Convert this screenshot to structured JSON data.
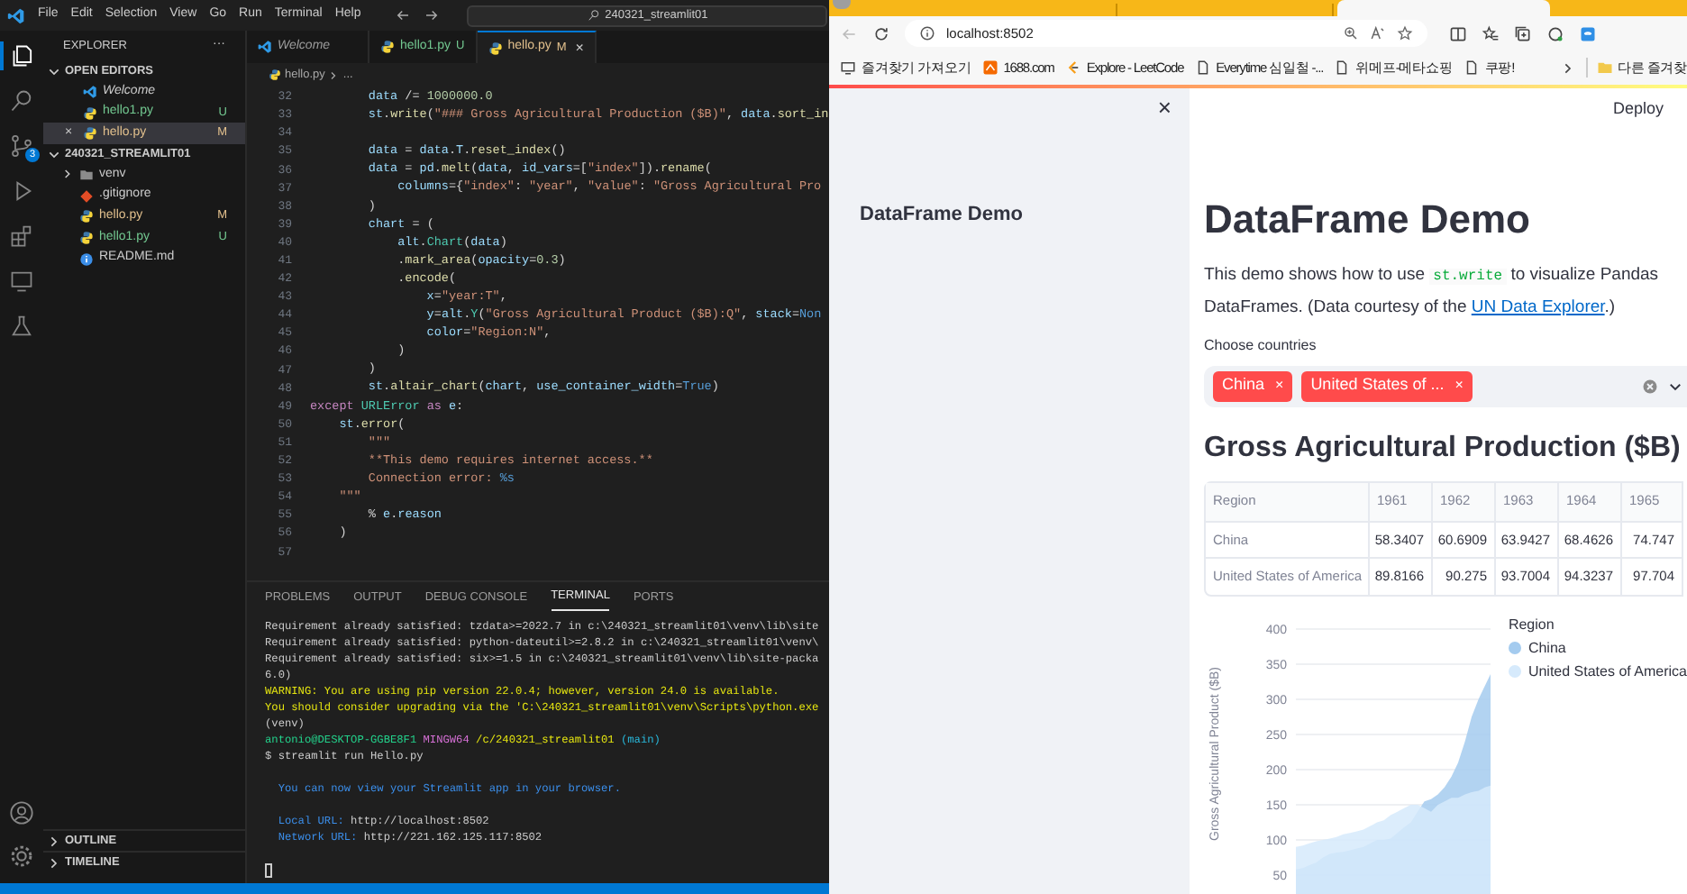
{
  "vscode": {
    "menu": [
      "File",
      "Edit",
      "Selection",
      "View",
      "Go",
      "Run",
      "Terminal",
      "Help"
    ],
    "command_center": "240321_streamlit01",
    "activity_bar": [
      {
        "kind": "explorer",
        "selected": true
      },
      {
        "kind": "search",
        "selected": false
      },
      {
        "kind": "source-control",
        "selected": false,
        "badge": "3"
      },
      {
        "kind": "run",
        "selected": false
      },
      {
        "kind": "extensions",
        "selected": false
      },
      {
        "kind": "remote",
        "selected": false
      },
      {
        "kind": "testing",
        "selected": false
      }
    ],
    "explorer": {
      "title": "EXPLORER",
      "more": "···",
      "open_editors": {
        "title": "OPEN EDITORS",
        "expanded": true,
        "items": [
          {
            "name": "Welcome",
            "kind": "vscode",
            "selected": false,
            "italic": true
          },
          {
            "name": "hello1.py",
            "kind": "python",
            "status": "U",
            "selected": false,
            "italic": false
          },
          {
            "name": "hello.py",
            "kind": "python",
            "status": "M",
            "selected": true,
            "italic": false,
            "close": "×"
          }
        ]
      },
      "folder": {
        "title": "240321_STREAMLIT01",
        "expanded": true,
        "items": [
          {
            "name": "venv",
            "kind": "folder"
          },
          {
            "name": ".gitignore",
            "kind": "git"
          },
          {
            "name": "hello.py",
            "kind": "python",
            "status": "M"
          },
          {
            "name": "hello1.py",
            "kind": "python",
            "status": "U"
          },
          {
            "name": "README.md",
            "kind": "info"
          }
        ]
      },
      "bottom_sections": [
        "OUTLINE",
        "TIMELINE"
      ]
    },
    "tabs": [
      {
        "label": "Welcome",
        "kind": "vscode",
        "selected": false
      },
      {
        "label": "hello1.py",
        "kind": "python",
        "status": "U",
        "selected": false
      },
      {
        "label": "hello.py",
        "kind": "python",
        "status": "M",
        "selected": true,
        "close": "×"
      }
    ],
    "breadcrumb": [
      "hello.py",
      "..."
    ],
    "code": [
      {
        "number": "32",
        "tokens": [
          {
            "kind": "var",
            "text": "        data"
          },
          {
            "kind": "op",
            "text": " /= "
          },
          {
            "kind": "num",
            "text": "1000000.0"
          }
        ]
      },
      {
        "number": "33",
        "tokens": [
          {
            "kind": "var",
            "text": "        st"
          },
          {
            "kind": "op",
            "text": "."
          },
          {
            "kind": "fn",
            "text": "write"
          },
          {
            "kind": "op",
            "text": "("
          },
          {
            "kind": "str",
            "text": "\"### Gross Agricultural Production ($B)\""
          },
          {
            "kind": "op",
            "text": ", "
          },
          {
            "kind": "var",
            "text": "data"
          },
          {
            "kind": "op",
            "text": "."
          },
          {
            "kind": "fn",
            "text": "sort_in"
          }
        ]
      },
      {
        "number": "34"
      },
      {
        "number": "35",
        "tokens": [
          {
            "kind": "var",
            "text": "        data"
          },
          {
            "kind": "op",
            "text": " = "
          },
          {
            "kind": "var",
            "text": "data"
          },
          {
            "kind": "op",
            "text": "."
          },
          {
            "kind": "var",
            "text": "T"
          },
          {
            "kind": "op",
            "text": "."
          },
          {
            "kind": "fn",
            "text": "reset_index"
          },
          {
            "kind": "op",
            "text": "()"
          }
        ]
      },
      {
        "number": "36",
        "tokens": [
          {
            "kind": "var",
            "text": "        data"
          },
          {
            "kind": "op",
            "text": " = "
          },
          {
            "kind": "var",
            "text": "pd"
          },
          {
            "kind": "op",
            "text": "."
          },
          {
            "kind": "fn",
            "text": "melt"
          },
          {
            "kind": "op",
            "text": "("
          },
          {
            "kind": "var",
            "text": "data"
          },
          {
            "kind": "op",
            "text": ", "
          },
          {
            "kind": "var",
            "text": "id_vars"
          },
          {
            "kind": "op",
            "text": "=["
          },
          {
            "kind": "str",
            "text": "\"index\""
          },
          {
            "kind": "op",
            "text": "])."
          },
          {
            "kind": "fn",
            "text": "rename"
          },
          {
            "kind": "op",
            "text": "("
          }
        ]
      },
      {
        "number": "37",
        "tokens": [
          {
            "kind": "var",
            "text": "            columns"
          },
          {
            "kind": "op",
            "text": "={"
          },
          {
            "kind": "str",
            "text": "\"index\""
          },
          {
            "kind": "op",
            "text": ": "
          },
          {
            "kind": "str",
            "text": "\"year\""
          },
          {
            "kind": "op",
            "text": ", "
          },
          {
            "kind": "str",
            "text": "\"value\""
          },
          {
            "kind": "op",
            "text": ": "
          },
          {
            "kind": "str",
            "text": "\"Gross Agricultural Pro"
          }
        ]
      },
      {
        "number": "38",
        "tokens": [
          {
            "kind": "op",
            "text": "        )"
          }
        ]
      },
      {
        "number": "39",
        "tokens": [
          {
            "kind": "var",
            "text": "        chart"
          },
          {
            "kind": "op",
            "text": " = ("
          }
        ]
      },
      {
        "number": "40",
        "tokens": [
          {
            "kind": "var",
            "text": "            alt"
          },
          {
            "kind": "op",
            "text": "."
          },
          {
            "kind": "cls",
            "text": "Chart"
          },
          {
            "kind": "op",
            "text": "("
          },
          {
            "kind": "var",
            "text": "data"
          },
          {
            "kind": "op",
            "text": ")"
          }
        ]
      },
      {
        "number": "41",
        "tokens": [
          {
            "kind": "op",
            "text": "            ."
          },
          {
            "kind": "fn",
            "text": "mark_area"
          },
          {
            "kind": "op",
            "text": "("
          },
          {
            "kind": "var",
            "text": "opacity"
          },
          {
            "kind": "op",
            "text": "="
          },
          {
            "kind": "num",
            "text": "0.3"
          },
          {
            "kind": "op",
            "text": ")"
          }
        ]
      },
      {
        "number": "42",
        "tokens": [
          {
            "kind": "op",
            "text": "            ."
          },
          {
            "kind": "fn",
            "text": "encode"
          },
          {
            "kind": "op",
            "text": "("
          }
        ]
      },
      {
        "number": "43",
        "tokens": [
          {
            "kind": "var",
            "text": "                x"
          },
          {
            "kind": "op",
            "text": "="
          },
          {
            "kind": "str",
            "text": "\"year:T\""
          },
          {
            "kind": "op",
            "text": ","
          }
        ]
      },
      {
        "number": "44",
        "tokens": [
          {
            "kind": "var",
            "text": "                y"
          },
          {
            "kind": "op",
            "text": "="
          },
          {
            "kind": "var",
            "text": "alt"
          },
          {
            "kind": "op",
            "text": "."
          },
          {
            "kind": "cls",
            "text": "Y"
          },
          {
            "kind": "op",
            "text": "("
          },
          {
            "kind": "str",
            "text": "\"Gross Agricultural Product ($B):Q\""
          },
          {
            "kind": "op",
            "text": ", "
          },
          {
            "kind": "var",
            "text": "stack"
          },
          {
            "kind": "op",
            "text": "="
          },
          {
            "kind": "const",
            "text": "Non"
          }
        ]
      },
      {
        "number": "45",
        "tokens": [
          {
            "kind": "var",
            "text": "                color"
          },
          {
            "kind": "op",
            "text": "="
          },
          {
            "kind": "str",
            "text": "\"Region:N\""
          },
          {
            "kind": "op",
            "text": ","
          }
        ]
      },
      {
        "number": "46",
        "tokens": [
          {
            "kind": "op",
            "text": "            )"
          }
        ]
      },
      {
        "number": "47",
        "tokens": [
          {
            "kind": "op",
            "text": "        )"
          }
        ]
      },
      {
        "number": "48",
        "tokens": [
          {
            "kind": "var",
            "text": "        st"
          },
          {
            "kind": "op",
            "text": "."
          },
          {
            "kind": "fn",
            "text": "altair_chart"
          },
          {
            "kind": "op",
            "text": "("
          },
          {
            "kind": "var",
            "text": "chart"
          },
          {
            "kind": "op",
            "text": ", "
          },
          {
            "kind": "var",
            "text": "use_container_width"
          },
          {
            "kind": "op",
            "text": "="
          },
          {
            "kind": "const",
            "text": "True"
          },
          {
            "kind": "op",
            "text": ")"
          }
        ]
      },
      {
        "number": "49",
        "tokens": [
          {
            "kind": "kw",
            "text": "except"
          },
          {
            "kind": "cls",
            "text": " URLError"
          },
          {
            "kind": "kw",
            "text": " as"
          },
          {
            "kind": "var",
            "text": " e"
          },
          {
            "kind": "op",
            "text": ":"
          }
        ]
      },
      {
        "number": "50",
        "tokens": [
          {
            "kind": "var",
            "text": "    st"
          },
          {
            "kind": "op",
            "text": "."
          },
          {
            "kind": "fn",
            "text": "error"
          },
          {
            "kind": "op",
            "text": "("
          }
        ]
      },
      {
        "number": "51",
        "tokens": [
          {
            "kind": "str",
            "text": "        \"\"\""
          }
        ]
      },
      {
        "number": "52",
        "tokens": [
          {
            "kind": "str",
            "text": "        **This demo requires internet access.**"
          }
        ]
      },
      {
        "number": "53",
        "tokens": [
          {
            "kind": "str",
            "text": "        Connection error: "
          },
          {
            "kind": "const",
            "text": "%s"
          }
        ]
      },
      {
        "number": "54",
        "tokens": [
          {
            "kind": "str",
            "text": "    \"\"\""
          }
        ]
      },
      {
        "number": "55",
        "tokens": [
          {
            "kind": "op",
            "text": "        % "
          },
          {
            "kind": "var",
            "text": "e"
          },
          {
            "kind": "op",
            "text": "."
          },
          {
            "kind": "var",
            "text": "reason"
          }
        ]
      },
      {
        "number": "56",
        "tokens": [
          {
            "kind": "op",
            "text": "    )"
          }
        ]
      },
      {
        "number": "57"
      }
    ],
    "panel_tabs": [
      {
        "label": "PROBLEMS",
        "selected": false
      },
      {
        "label": "OUTPUT",
        "selected": false
      },
      {
        "label": "DEBUG CONSOLE",
        "selected": false
      },
      {
        "label": "TERMINAL",
        "selected": true
      },
      {
        "label": "PORTS",
        "selected": false
      }
    ],
    "terminal": [
      [
        [
          {
            "kind": "plain",
            "text": "Requirement already satisfied: tzdata>=2022.7 in c:\\240321_streamlit01\\venv\\lib\\site"
          }
        ],
        [
          {
            "kind": "plain",
            "text": "Requirement already satisfied: python-dateutil>=2.8.2 in c:\\240321_streamlit01\\venv\\"
          }
        ],
        [
          {
            "kind": "plain",
            "text": "Requirement already satisfied: six>=1.5 in c:\\240321_streamlit01\\venv\\lib\\site-packa"
          }
        ],
        [
          {
            "kind": "plain",
            "text": "6.0)"
          }
        ],
        [
          {
            "kind": "warn",
            "text": "WARNING: You are using pip version 22.0.4; however, version 24.0 is available."
          }
        ],
        [
          {
            "kind": "warn",
            "text": "You should consider upgrading via the 'C:\\240321_streamlit01\\venv\\Scripts\\python.exe"
          }
        ],
        [
          {
            "kind": "plain",
            "text": "(venv)"
          }
        ],
        [
          {
            "kind": "user",
            "text": "antonio@DESKTOP-GGBE8F1"
          },
          {
            "kind": "shell",
            "text": " MINGW64"
          },
          {
            "kind": "warn",
            "text": " /c/240321_streamlit01"
          },
          {
            "kind": "branch",
            "text": " (main)"
          }
        ],
        [
          {
            "kind": "plain",
            "text": "$ streamlit run Hello.py"
          }
        ]
      ],
      [
        [
          {
            "kind": "info",
            "text": "  You can now view your Streamlit app in your browser."
          }
        ]
      ],
      [
        [
          {
            "kind": "info",
            "text": "  Local URL: "
          },
          {
            "kind": "plain",
            "text": "http://localhost:8502"
          }
        ],
        [
          {
            "kind": "info",
            "text": "  Network URL: "
          },
          {
            "kind": "plain",
            "text": "http://221.162.125.117:8502"
          }
        ]
      ]
    ]
  },
  "browser": {
    "address": "localhost:8502",
    "bookmarks": [
      {
        "label": "즐겨찾기 가져오기",
        "kind": "import"
      },
      {
        "label": "1688.com",
        "kind": "site"
      },
      {
        "label": "Explore - LeetCode",
        "kind": "leetcode"
      },
      {
        "label": "Everytime 심일철 -...",
        "kind": "page"
      },
      {
        "label": "위메프-메타쇼핑",
        "kind": "page"
      },
      {
        "label": "쿠팡!",
        "kind": "page"
      }
    ],
    "more_bookmarks": "다른 즐겨찾"
  },
  "app": {
    "deploy": "Deploy",
    "sidebar": {
      "expanded": true,
      "close": "×",
      "items": [
        "DataFrame Demo"
      ]
    },
    "title": "DataFrame Demo",
    "intro": {
      "before": "This demo shows how to use ",
      "code": "st.write",
      "after": " to visualize Pandas DataFrames. (Data courtesy of the ",
      "link": "UN Data Explorer",
      "end": ".)"
    },
    "multiselect": {
      "label": "Choose countries",
      "selected": [
        {
          "label": "China",
          "remove": "×"
        },
        {
          "label": "United States of ...",
          "remove": "×"
        }
      ]
    },
    "heading": "Gross Agricultural Production ($B)",
    "table": {
      "columns": [
        "Region",
        "1961",
        "1962",
        "1963",
        "1964",
        "1965"
      ],
      "rows": [
        [
          "China",
          "58.3407",
          "60.6909",
          "63.9427",
          "68.4626",
          "74.747"
        ],
        [
          "United States of America",
          "89.8166",
          "90.275",
          "93.7004",
          "94.3237",
          "97.704"
        ]
      ]
    },
    "chart": {
      "ylabel": "Gross Agricultural Product ($B)",
      "yticks": [
        "400",
        "350",
        "300",
        "250",
        "200",
        "150",
        "100",
        "50"
      ],
      "legend_title": "Region",
      "series": [
        {
          "name": "China",
          "color": "#a4cbef"
        },
        {
          "name": "United States of America",
          "color": "#d6eafc"
        }
      ]
    }
  }
}
